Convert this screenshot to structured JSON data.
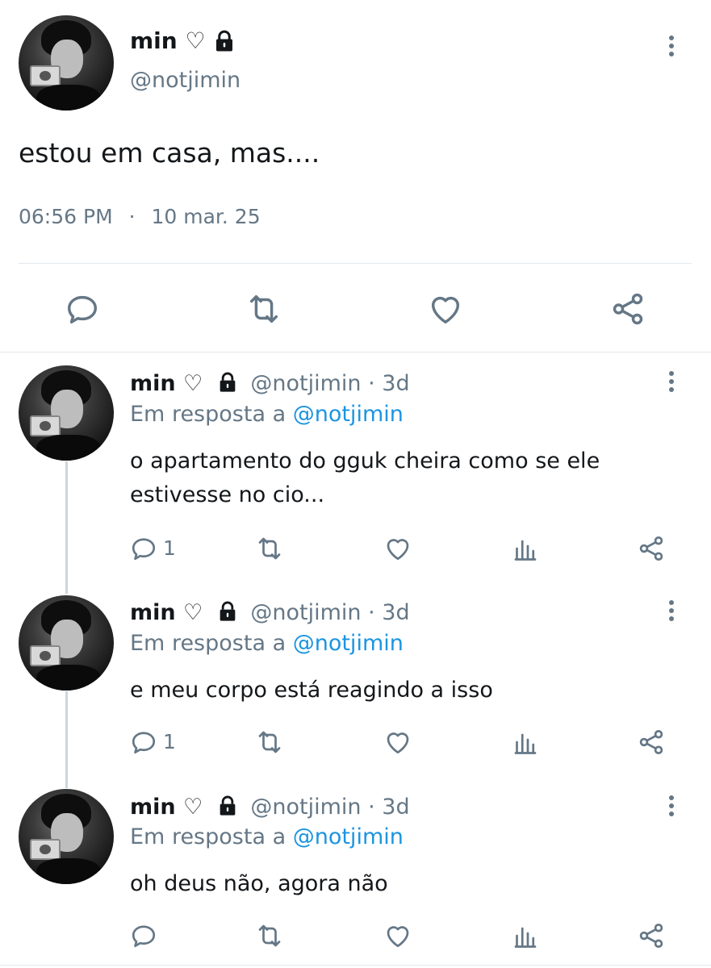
{
  "main_tweet": {
    "name": "min ♡",
    "handle": "@notjimin",
    "text": "estou em casa, mas....",
    "time": "06:56 PM",
    "separator": "·",
    "date": "10 mar. 25"
  },
  "replies": [
    {
      "name": "min ♡",
      "handle": "@notjimin",
      "age": "· 3d",
      "reply_prefix": "Em resposta a",
      "reply_to": "@notjimin",
      "text_line1": "o apartamento do gguk cheira como se ele",
      "text_line2": "estivesse no cio...",
      "reply_count": "1"
    },
    {
      "name": "min ♡",
      "handle": "@notjimin",
      "age": "· 3d",
      "reply_prefix": "Em resposta a",
      "reply_to": "@notjimin",
      "text_line1": "e meu corpo está reagindo a isso",
      "reply_count": "1"
    },
    {
      "name": "min ♡",
      "handle": "@notjimin",
      "age": "· 3d",
      "reply_prefix": "Em resposta a",
      "reply_to": "@notjimin",
      "text_line1": "oh deus não, agora não",
      "reply_count": ""
    }
  ],
  "icons": {
    "lock": "lock-icon",
    "reply": "comment-bubble-icon",
    "retweet": "retweet-arrows-icon",
    "like": "heart-outline-icon",
    "analytics": "bar-chart-icon",
    "share": "share-nodes-icon",
    "more": "vertical-dots-icon"
  },
  "colors": {
    "text": "#14171a",
    "muted": "#657786",
    "link": "#1b95e0",
    "divider": "#e1e8ed"
  }
}
